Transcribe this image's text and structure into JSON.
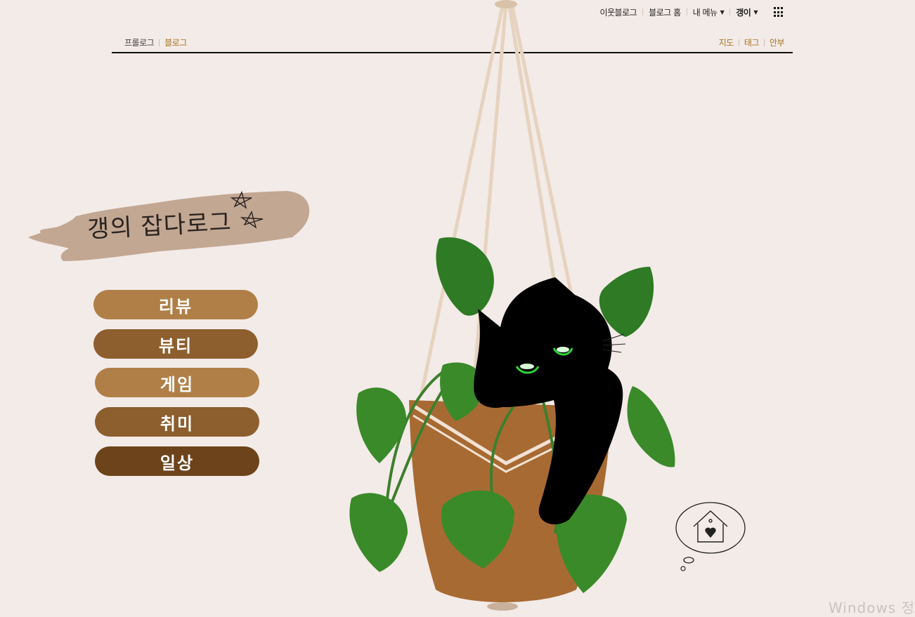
{
  "gnb": {
    "neighbor_blog": "이웃블로그",
    "blog_home": "블로그 홈",
    "my_menu": "내 메뉴",
    "user_name": "갱이"
  },
  "topmenu": {
    "left": [
      "프롤로그",
      "블로그"
    ],
    "right": [
      "지도",
      "태그",
      "안부"
    ]
  },
  "blog_title": "갱의 잡다로그",
  "categories": [
    {
      "label": "리뷰",
      "color": "#b07f47"
    },
    {
      "label": "뷰티",
      "color": "#8d5e2e"
    },
    {
      "label": "게임",
      "color": "#b07f47"
    },
    {
      "label": "취미",
      "color": "#8d5e2e"
    },
    {
      "label": "일상",
      "color": "#6c431a"
    }
  ],
  "watermark": "Windows 정"
}
